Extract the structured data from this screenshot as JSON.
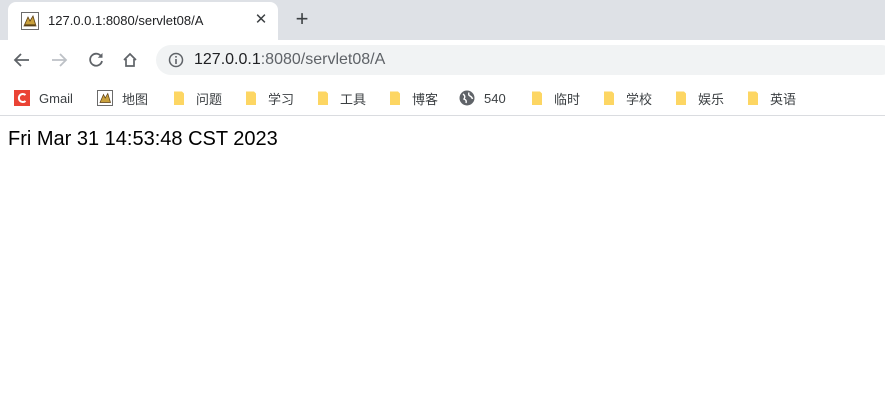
{
  "tab": {
    "title": "127.0.0.1:8080/servlet08/A",
    "close_glyph": "✕",
    "favicon": "tomcat-icon"
  },
  "new_tab_glyph": "+",
  "address_bar": {
    "host": "127.0.0.1",
    "rest": ":8080/servlet08/A"
  },
  "bookmarks": [
    {
      "label": "Gmail",
      "icon": "gmail-icon"
    },
    {
      "label": "地图",
      "icon": "tomcat-icon"
    },
    {
      "label": "问题",
      "icon": "folder-icon"
    },
    {
      "label": "学习",
      "icon": "folder-icon"
    },
    {
      "label": "工具",
      "icon": "folder-icon"
    },
    {
      "label": "博客",
      "icon": "folder-icon"
    },
    {
      "label": "540",
      "icon": "globe-icon"
    },
    {
      "label": "临时",
      "icon": "folder-icon"
    },
    {
      "label": "学校",
      "icon": "folder-icon"
    },
    {
      "label": "娱乐",
      "icon": "folder-icon"
    },
    {
      "label": "英语",
      "icon": "folder-icon"
    }
  ],
  "page": {
    "text": "Fri Mar 31 14:53:48 CST 2023"
  },
  "colors": {
    "tab_strip": "#dee1e6",
    "omnibox": "#f1f3f4",
    "folder": "#fdd663",
    "gmail_red": "#ea4335"
  }
}
